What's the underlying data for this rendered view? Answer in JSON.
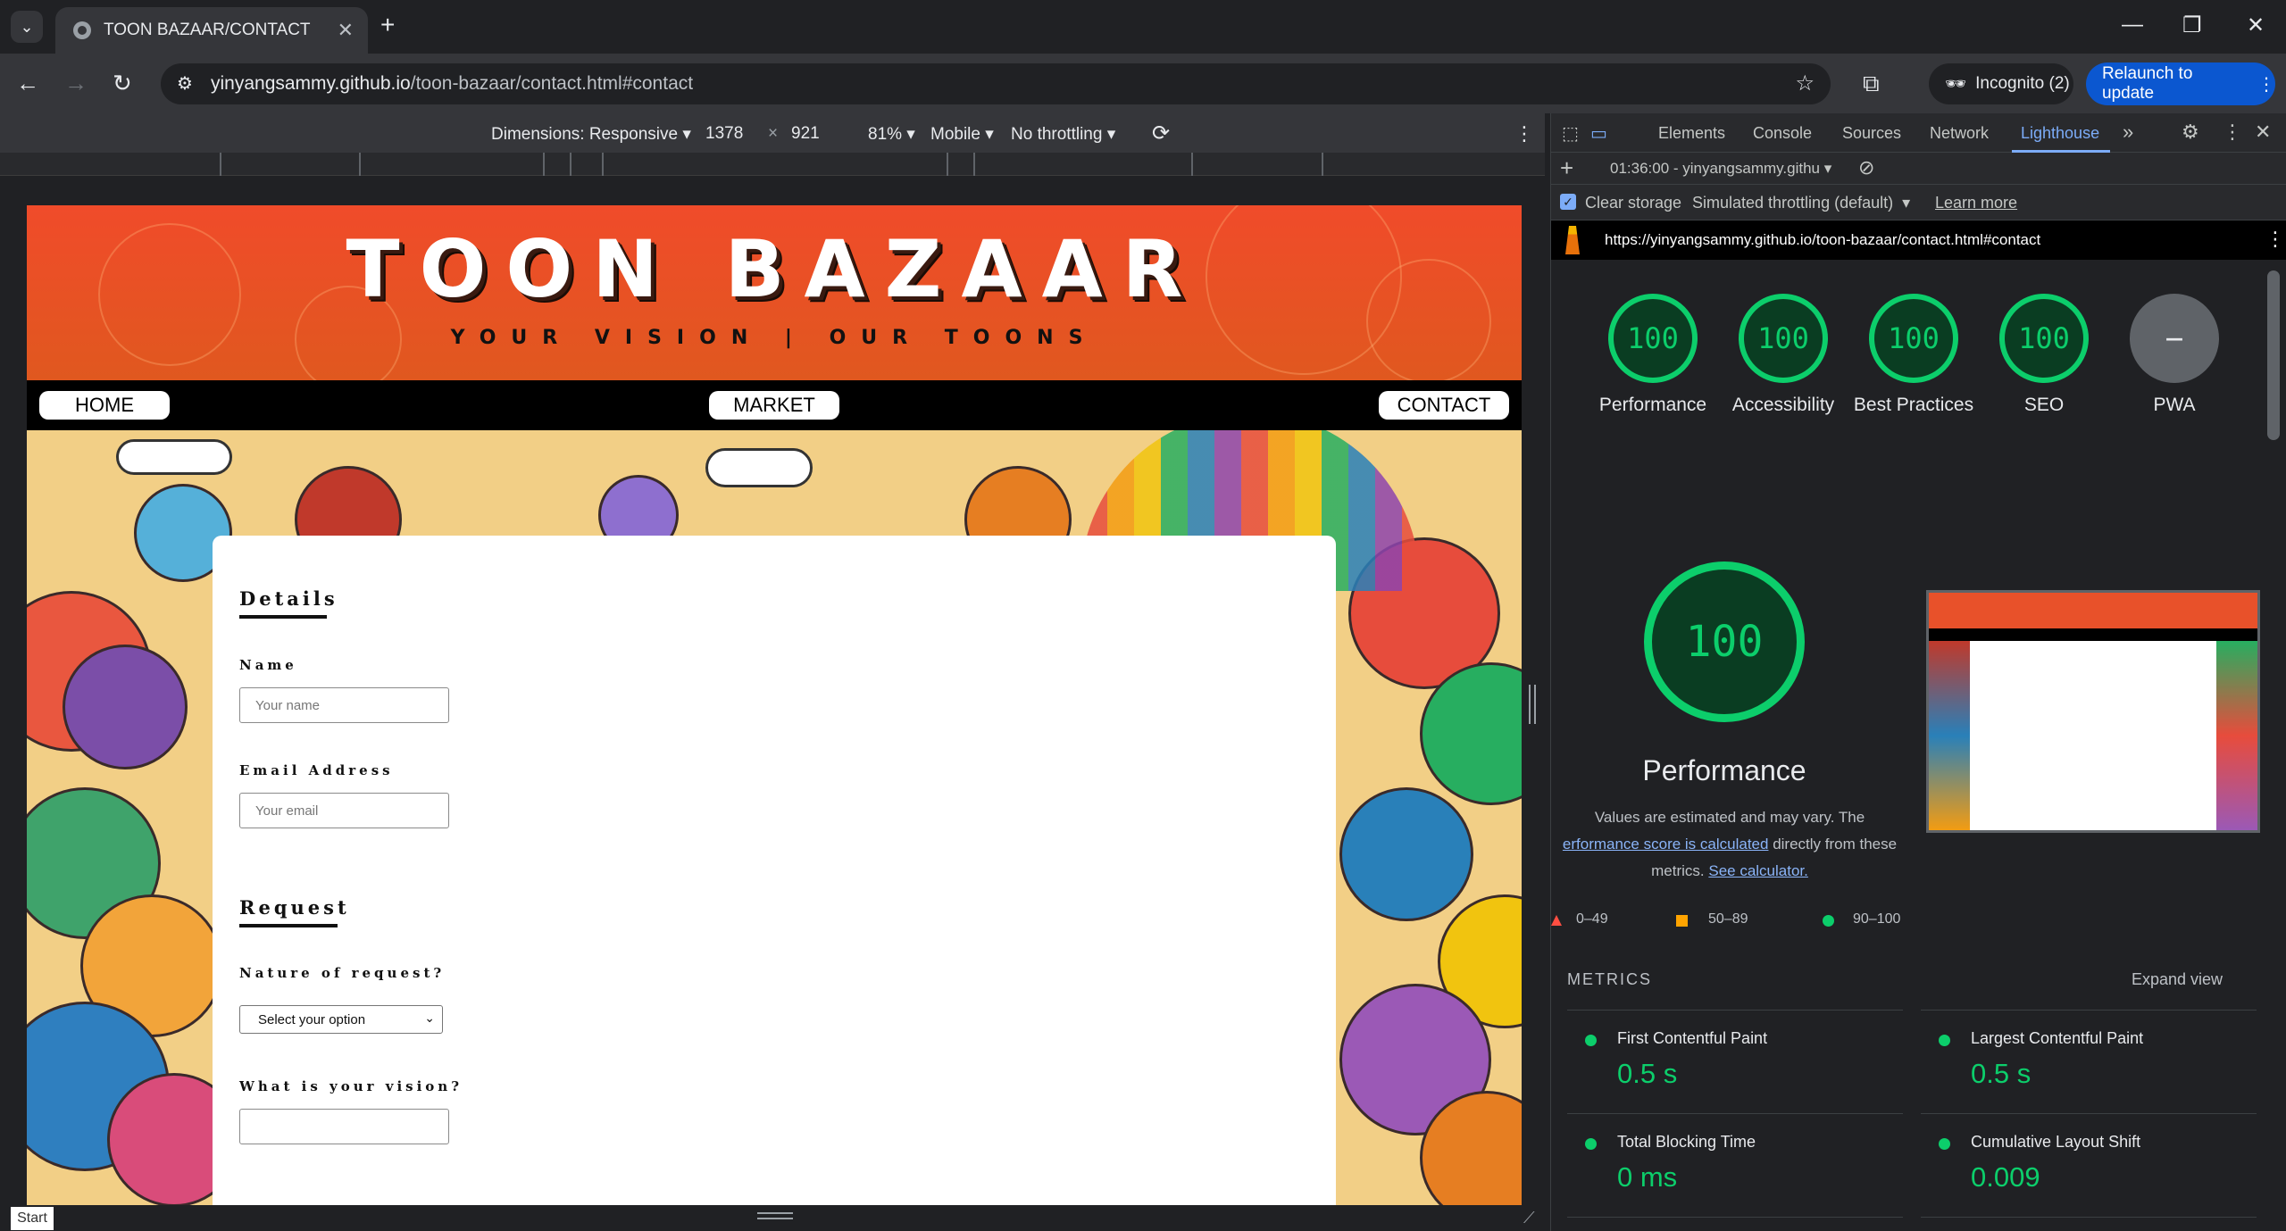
{
  "browser": {
    "tab_title": "TOON BAZAAR/CONTACT",
    "url_host": "yinyangsammy.github.io",
    "url_path": "/toon-bazaar/contact.html#contact",
    "incognito_label": "Incognito (2)",
    "relaunch_label": "Relaunch to update"
  },
  "device_toolbar": {
    "dimensions_label": "Dimensions: Responsive",
    "width": "1378",
    "times": "×",
    "height": "921",
    "zoom": "81%",
    "device": "Mobile",
    "throttling": "No throttling"
  },
  "site": {
    "brand": "TOON BAZAAR",
    "tagline": "YOUR VISION | OUR TOONS",
    "nav": {
      "home": "HOME",
      "market": "MARKET",
      "contact": "CONTACT"
    },
    "form": {
      "details_heading": "Details",
      "name_label": "Name",
      "name_placeholder": "Your name",
      "email_label": "Email Address",
      "email_placeholder": "Your email",
      "request_heading": "Request",
      "nature_label": "Nature of request?",
      "nature_selected": "Select your option",
      "vision_label": "What is your vision?"
    }
  },
  "start_label": "Start",
  "devtools": {
    "tabs": [
      "Elements",
      "Console",
      "Sources",
      "Network",
      "Lighthouse"
    ],
    "active_tab": "Lighthouse",
    "report_label": "01:36:00 - yinyangsammy.githu",
    "clear_storage": "Clear storage",
    "throttling_mode": "Simulated throttling (default)",
    "learn_more": "Learn more",
    "report_url": "https://yinyangsammy.github.io/toon-bazaar/contact.html#contact",
    "scores": [
      {
        "label": "Performance",
        "value": "100"
      },
      {
        "label": "Accessibility",
        "value": "100"
      },
      {
        "label": "Best Practices",
        "value": "100"
      },
      {
        "label": "SEO",
        "value": "100"
      },
      {
        "label": "PWA",
        "value": "PWA"
      }
    ],
    "big_score": "100",
    "big_label": "Performance",
    "note_1": "Values are estimated and may vary. The",
    "note_link": "erformance score is calculated",
    "note_2": "directly from these",
    "note_3": "metrics.",
    "calc_link": "See calculator.",
    "legend": [
      "0–49",
      "50–89",
      "90–100"
    ],
    "metrics_heading": "METRICS",
    "expand_view": "Expand view",
    "metrics": [
      {
        "name": "First Contentful Paint",
        "value": "0.5 s"
      },
      {
        "name": "Largest Contentful Paint",
        "value": "0.5 s"
      },
      {
        "name": "Total Blocking Time",
        "value": "0 ms"
      },
      {
        "name": "Cumulative Layout Shift",
        "value": "0.009"
      }
    ],
    "colors": {
      "pass": "#0cce6b",
      "average": "#ffa400",
      "fail": "#ff4e42"
    }
  }
}
